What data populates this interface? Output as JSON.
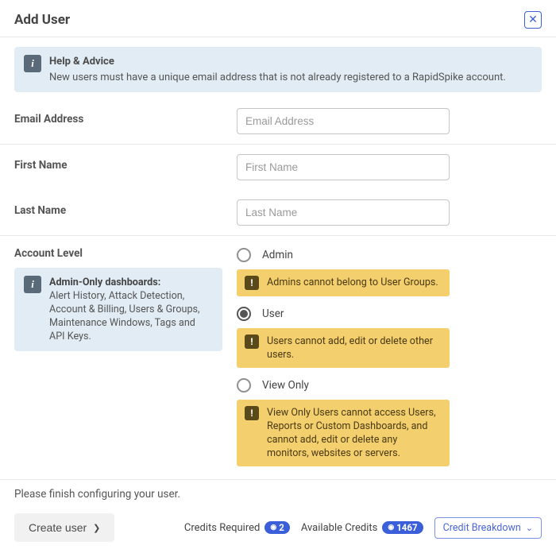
{
  "header": {
    "title": "Add User"
  },
  "advice": {
    "title": "Help & Advice",
    "text": "New users must have a unique email address that is not already registered to a RapidSpike account."
  },
  "fields": {
    "email": {
      "label": "Email Address",
      "placeholder": "Email Address",
      "value": ""
    },
    "first_name": {
      "label": "First Name",
      "placeholder": "First Name",
      "value": ""
    },
    "last_name": {
      "label": "Last Name",
      "placeholder": "Last Name",
      "value": ""
    }
  },
  "account_level": {
    "label": "Account Level",
    "admin_only": {
      "title": "Admin-Only dashboards:",
      "text": "Alert History, Attack Detection, Account & Billing, Users & Groups, Maintenance Windows, Tags and API Keys."
    },
    "options": {
      "admin": {
        "label": "Admin",
        "checked": false,
        "note": "Admins cannot belong to User Groups."
      },
      "user": {
        "label": "User",
        "checked": true,
        "note": "Users cannot add, edit or delete other users."
      },
      "view_only": {
        "label": "View Only",
        "checked": false,
        "note": "View Only Users cannot access Users, Reports or Custom Dashboards, and cannot add, edit or delete any monitors, websites or servers."
      }
    }
  },
  "finish_text": "Please finish configuring your user.",
  "footer": {
    "create_label": "Create user",
    "credits_required_label": "Credits Required",
    "credits_required_value": "2",
    "available_credits_label": "Available Credits",
    "available_credits_value": "1467",
    "breakdown_label": "Credit Breakdown"
  }
}
